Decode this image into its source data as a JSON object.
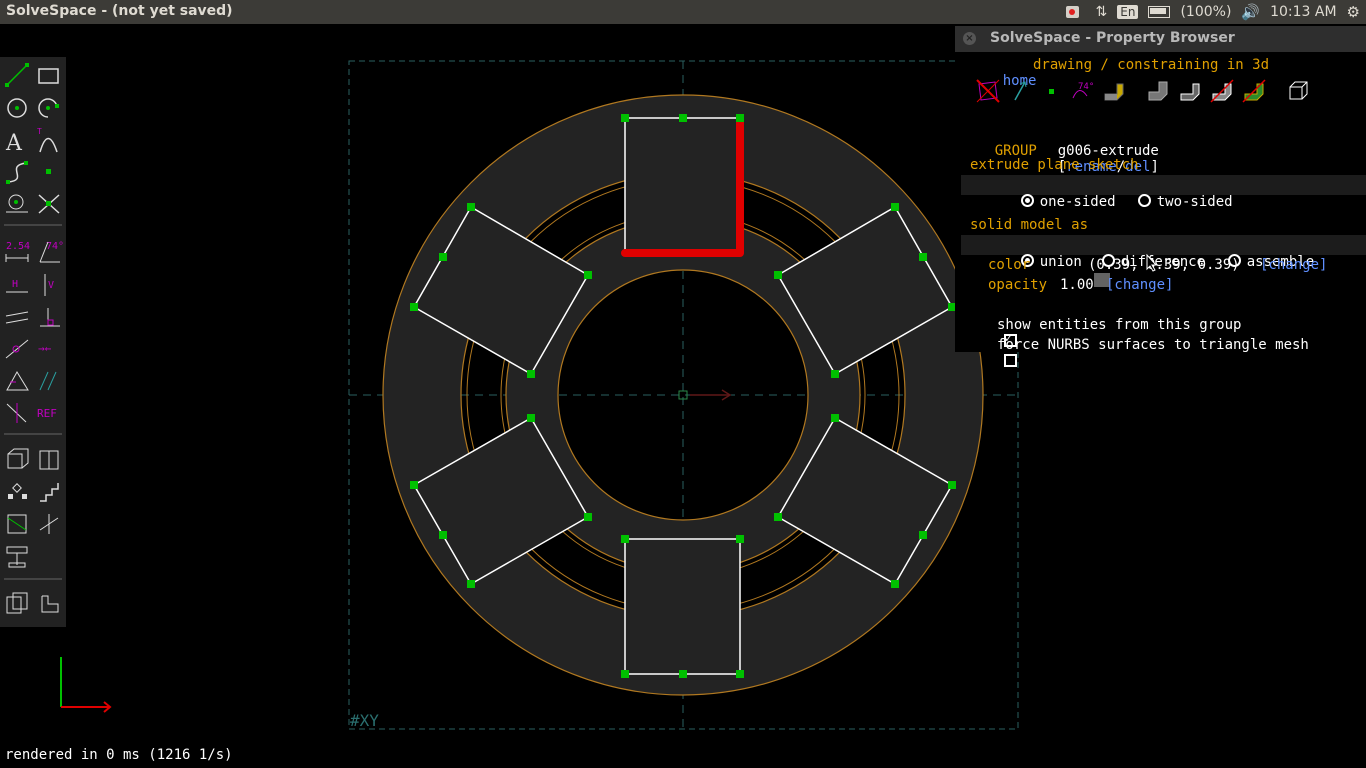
{
  "window": {
    "title": "SolveSpace - (not yet saved)"
  },
  "tray": {
    "keyboard": "En",
    "battery": "(100%)",
    "clock": "10:13 AM"
  },
  "toolbar": {
    "tools": [
      "line",
      "rectangle",
      "circle",
      "arc",
      "text",
      "tangent-arc",
      "cubic-spline",
      "datum-point",
      "workplane",
      "split-curves",
      "distance-dimension",
      "angle-dimension",
      "horizontal",
      "vertical",
      "parallel",
      "perpendicular",
      "point-on-entity",
      "symmetric",
      "equal",
      "same-orientation",
      "other-supplementary",
      "reference",
      "nearest-iso-view",
      "nearest-ortho-view",
      "step-translating",
      "step-rotating",
      "extrude",
      "sketch-in-3d",
      "revolve",
      "sketch-in-workplane",
      "assemble"
    ],
    "ref_label": "REF",
    "dim_label": "2.54",
    "angle_label": "74°",
    "h_label": "H",
    "v_label": "V"
  },
  "property_browser": {
    "title": "SolveSpace - Property Browser",
    "nav": {
      "home": "home",
      "path": "drawing / constraining in 3d"
    },
    "angle_badge": "74°",
    "group_label": "GROUP",
    "group_name": "g006-extrude",
    "rename": "rename",
    "del": "del",
    "extrude_heading": "extrude plane sketch",
    "one_sided": "one-sided",
    "two_sided": "two-sided",
    "solid_heading": "solid model as",
    "union": "union",
    "difference": "difference",
    "assemble": "assemble",
    "color_label": "color",
    "color_value": "(0.39, 0.39, 0.39)",
    "change": "[change]",
    "opacity_label": "opacity",
    "opacity_value": "1.00",
    "show_entities": "show entities from this group",
    "force_nurbs": "force NURBS surfaces to triangle mesh",
    "show_entities_checked": true,
    "force_nurbs_checked": false
  },
  "canvas": {
    "workplane_label": "#XY"
  },
  "status": {
    "text": "rendered in 0 ms (1216 1/s)"
  },
  "colors": {
    "accent_link": "#5f8fff",
    "heading": "#e0a000",
    "selection": "#e00000",
    "points": "#00c000",
    "face": "#232323",
    "outline": "#b07820"
  }
}
